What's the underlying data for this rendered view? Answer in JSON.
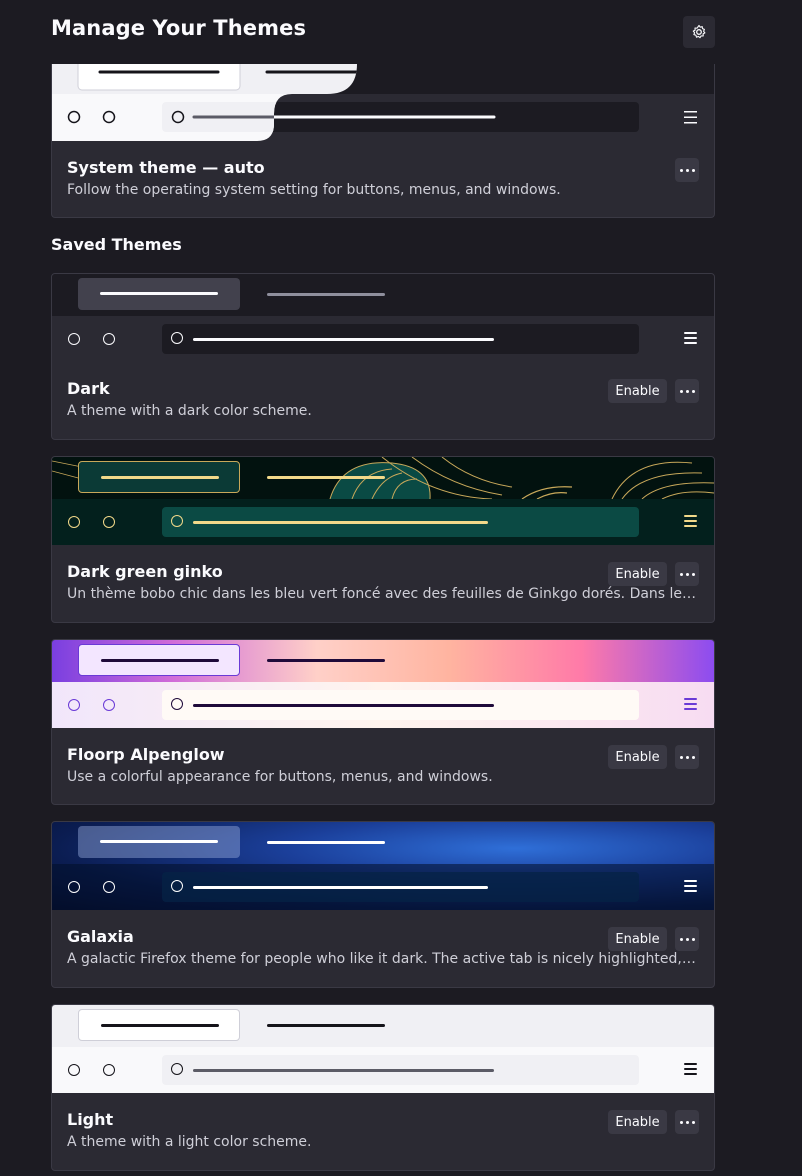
{
  "header": {
    "title": "Manage Your Themes",
    "settings_icon": "gear-icon"
  },
  "active_theme": {
    "name": "System theme — auto",
    "description": "Follow the operating system setting for buttons, menus, and windows."
  },
  "saved": {
    "title": "Saved Themes",
    "enable_label": "Enable",
    "themes": [
      {
        "name": "Dark",
        "description": "A theme with a dark color scheme."
      },
      {
        "name": "Dark green ginko",
        "description": "Un thème bobo chic dans les bleu vert foncé avec des feuilles de Ginkgo dorés. Dans les tons verts d'eau profonds, créé pour Firefox."
      },
      {
        "name": "Floorp Alpenglow",
        "description": "Use a colorful appearance for buttons, menus, and windows."
      },
      {
        "name": "Galaxia",
        "description": "A galactic Firefox theme for people who like it dark. The active tab is nicely highlighted, so you always know where you are."
      },
      {
        "name": "Light",
        "description": "A theme with a light color scheme."
      }
    ]
  },
  "colors": {
    "page_bg": "#1c1b22",
    "card_bg": "#2b2a33",
    "text": "#fbfbfe",
    "muted_text": "#cfcfd8",
    "button_bg": "#3a3944"
  }
}
